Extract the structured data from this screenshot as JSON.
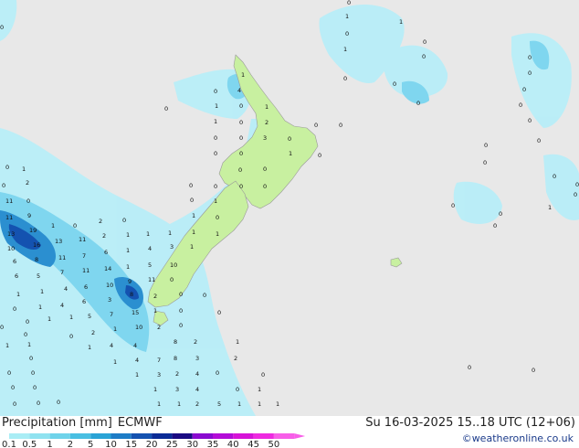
{
  "title": {
    "label": "Precipitation [mm]",
    "model": "ECMWF"
  },
  "valid_time": "Su 16-03-2025 15..18 UTC (12+06)",
  "credit": "©weatheronline.co.uk",
  "legend": {
    "levels": [
      "0.1",
      "0.5",
      "1",
      "2",
      "5",
      "10",
      "15",
      "20",
      "25",
      "30",
      "35",
      "40",
      "45",
      "50"
    ],
    "colors": [
      "#a9edf5",
      "#8fe2f0",
      "#6fd3ea",
      "#49bfe2",
      "#2aa3d6",
      "#1d7cc6",
      "#1452b0",
      "#0a2b96",
      "#1a0a82",
      "#8a0ad0",
      "#b30cd8",
      "#d613d8",
      "#ee2ae0",
      "#f75ee8"
    ]
  },
  "colors": {
    "sea": "#e8e8e8",
    "land": "#c8f0a0",
    "precip_light": "#b8eef8",
    "precip_mid": "#7fd6ef",
    "precip_heavy": "#2b8fd0"
  },
  "point_values": [
    "0",
    "1",
    "2",
    "3",
    "4",
    "5",
    "6",
    "7",
    "8",
    "9",
    "10",
    "11",
    "12",
    "13",
    "14",
    "15",
    "16",
    "18",
    "19"
  ]
}
